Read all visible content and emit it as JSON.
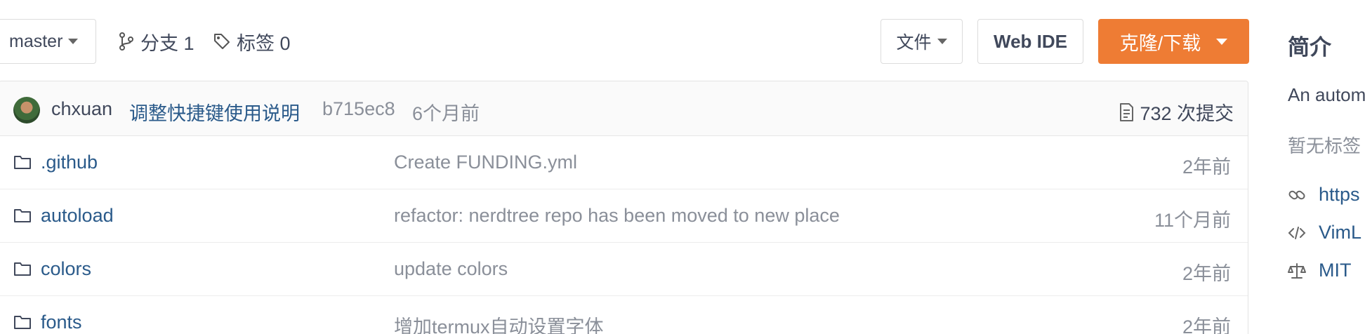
{
  "toolbar": {
    "branch": "master",
    "branches_label": "分支 1",
    "tags_label": "标签 0",
    "file_label": "文件",
    "webide_label": "Web IDE",
    "clone_label": "克隆/下载"
  },
  "commit": {
    "author": "chxuan",
    "message": "调整快捷键使用说明",
    "sha": "b715ec8",
    "time": "6个月前",
    "count": "732 次提交"
  },
  "files": [
    {
      "name": ".github",
      "message": "Create FUNDING.yml",
      "time": "2年前"
    },
    {
      "name": "autoload",
      "message": "refactor: nerdtree repo has been moved to new place",
      "time": "11个月前"
    },
    {
      "name": "colors",
      "message": "update colors",
      "time": "2年前"
    },
    {
      "name": "fonts",
      "message": "增加termux自动设置字体",
      "time": "2年前"
    }
  ],
  "sidebar": {
    "title": "简介",
    "description": "An autom",
    "no_tags": "暂无标签",
    "link": "https",
    "language": "VimL",
    "license": "MIT"
  },
  "colors": {
    "accent": "#ee7c34",
    "link": "#2a5a8a",
    "muted": "#8a8f99"
  },
  "icons": [
    "branch-icon",
    "tag-icon",
    "commit-list-icon",
    "folder-icon",
    "link-icon",
    "code-icon",
    "scale-icon"
  ]
}
